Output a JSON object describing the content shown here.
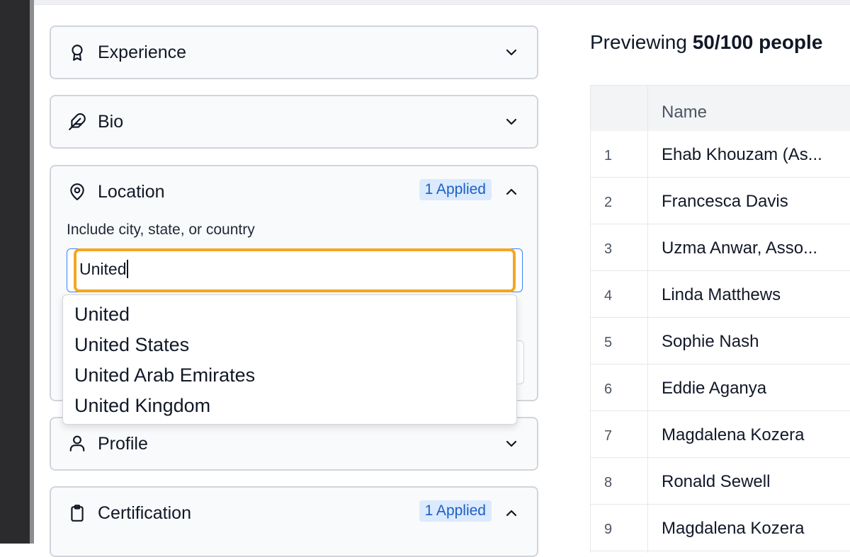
{
  "filters": {
    "experience": {
      "title": "Experience",
      "icon": "award-ribbon-icon"
    },
    "bio": {
      "title": "Bio",
      "icon": "feather-icon"
    },
    "location": {
      "title": "Location",
      "icon": "map-pin-icon",
      "badge": "1 Applied",
      "field_label": "Include city, state, or country",
      "input_value": "United",
      "suggestions": [
        "United",
        "United States",
        "United Arab Emirates",
        "United Kingdom"
      ]
    },
    "profile": {
      "title": "Profile",
      "icon": "user-icon"
    },
    "certification": {
      "title": "Certification",
      "icon": "clipboard-icon",
      "badge": "1 Applied"
    }
  },
  "preview": {
    "prefix": "Previewing ",
    "count": "50/100 people"
  },
  "table": {
    "header_name": "Name",
    "rows": [
      {
        "num": "1",
        "name": "Ehab Khouzam (As..."
      },
      {
        "num": "2",
        "name": "Francesca Davis"
      },
      {
        "num": "3",
        "name": "Uzma Anwar, Asso..."
      },
      {
        "num": "4",
        "name": "Linda Matthews"
      },
      {
        "num": "5",
        "name": "Sophie Nash"
      },
      {
        "num": "6",
        "name": "Eddie Aganya"
      },
      {
        "num": "7",
        "name": "Magdalena Kozera"
      },
      {
        "num": "8",
        "name": "Ronald Sewell"
      },
      {
        "num": "9",
        "name": "Magdalena Kozera"
      }
    ]
  },
  "colors": {
    "badge_bg": "#dbeafe",
    "badge_text": "#1d5fc2",
    "input_highlight": "#f5a623",
    "input_focus": "#3b82f6"
  }
}
